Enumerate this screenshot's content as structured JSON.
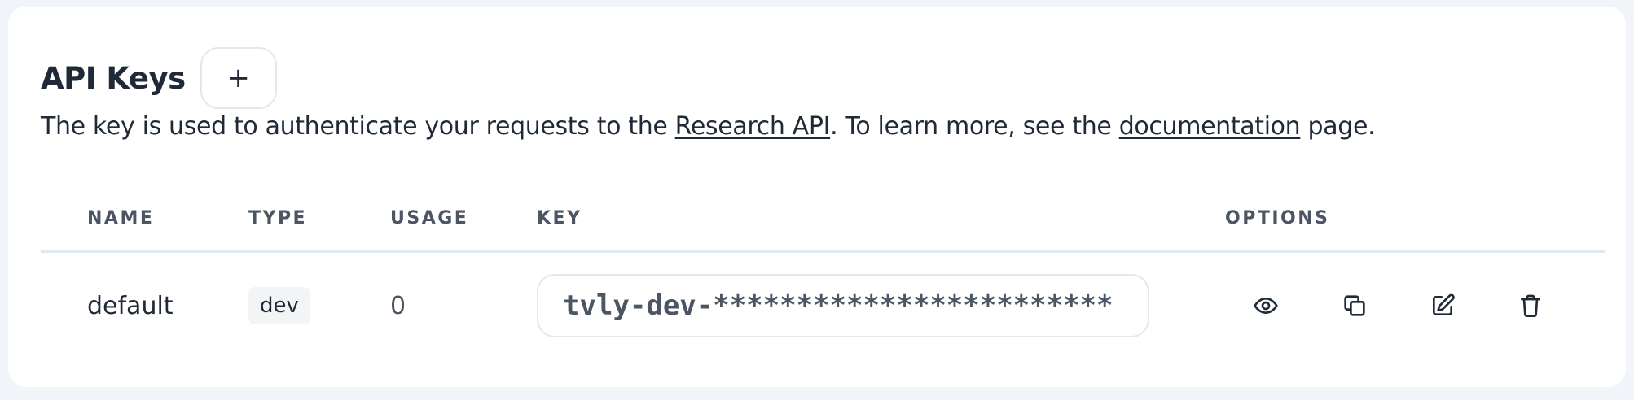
{
  "header": {
    "title": "API Keys",
    "add_label": "+"
  },
  "description": {
    "before": "The key is used to authenticate your requests to the ",
    "link1": "Research API",
    "middle": ". To learn more, see the ",
    "link2": "documentation",
    "after": " page."
  },
  "table": {
    "columns": {
      "name": "NAME",
      "type": "TYPE",
      "usage": "USAGE",
      "key": "KEY",
      "options": "OPTIONS"
    },
    "rows": [
      {
        "name": "default",
        "type": "dev",
        "usage": "0",
        "key": "tvly-dev-************************",
        "options": [
          "eye-icon",
          "copy-icon",
          "edit-icon",
          "trash-icon"
        ]
      }
    ]
  }
}
